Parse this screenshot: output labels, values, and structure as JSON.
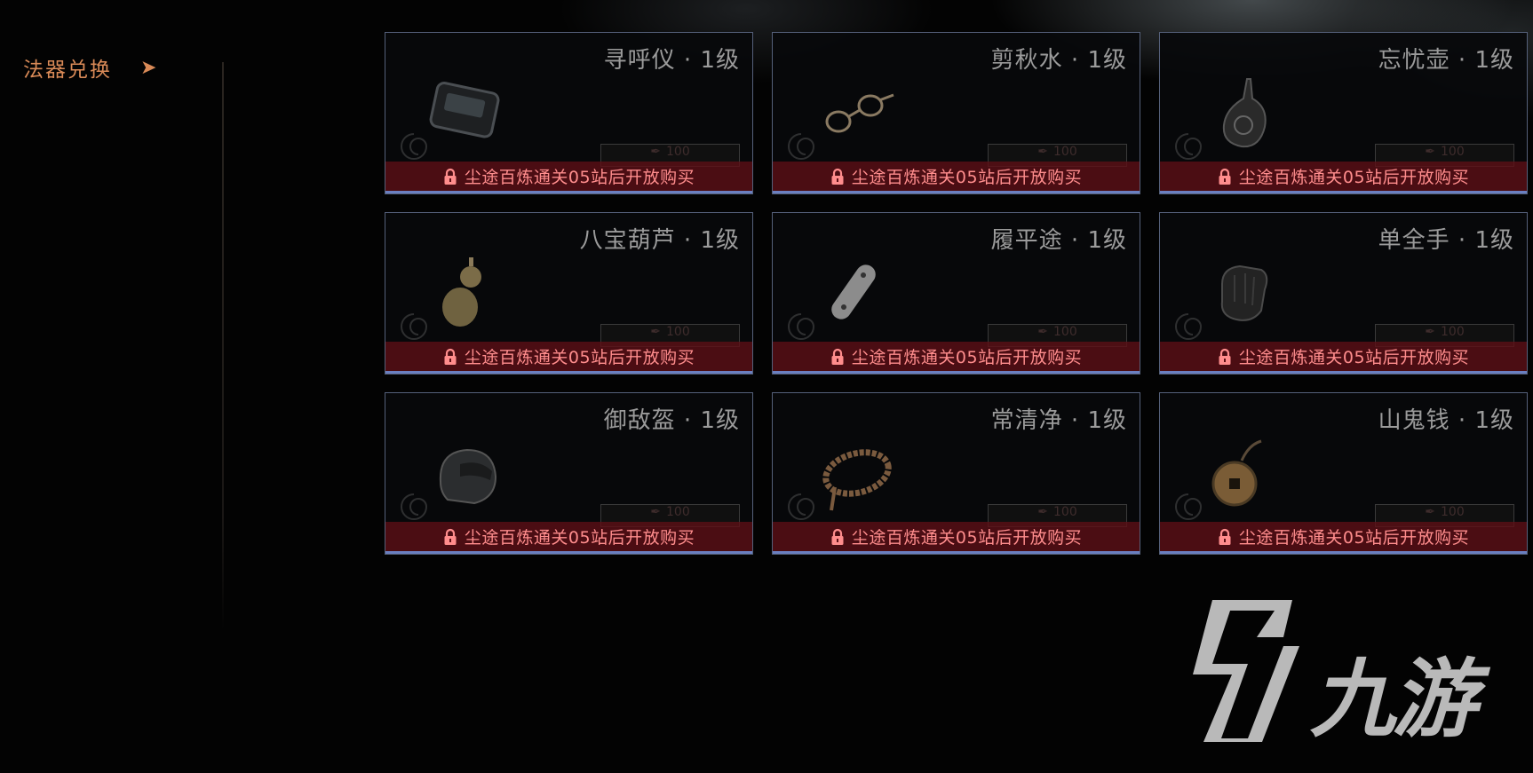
{
  "colors": {
    "accent": "#d98a57",
    "card_border": "#55607a",
    "card_accent_line": "#6a7fc0",
    "lock_bar": "#5f1016",
    "lock_text": "#ff8d8d",
    "title_text": "#9b9b9b"
  },
  "sidebar": {
    "label": "法器兑换",
    "arrow": "➤"
  },
  "lock_icon": "lock-icon",
  "items": [
    {
      "name": "寻呼仪 · 1级",
      "icon": "pager-icon",
      "price": "100",
      "lock_text": "尘途百炼通关05站后开放购买"
    },
    {
      "name": "剪秋水 · 1级",
      "icon": "glasses-icon",
      "price": "100",
      "lock_text": "尘途百炼通关05站后开放购买"
    },
    {
      "name": "忘忧壶 · 1级",
      "icon": "vase-icon",
      "price": "100",
      "lock_text": "尘途百炼通关05站后开放购买"
    },
    {
      "name": "八宝葫芦 · 1级",
      "icon": "gourd-icon",
      "price": "100",
      "lock_text": "尘途百炼通关05站后开放购买"
    },
    {
      "name": "履平途 · 1级",
      "icon": "skateboard-icon",
      "price": "100",
      "lock_text": "尘途百炼通关05站后开放购买"
    },
    {
      "name": "单全手 · 1级",
      "icon": "glove-icon",
      "price": "100",
      "lock_text": "尘途百炼通关05站后开放购买"
    },
    {
      "name": "御敌盔 · 1级",
      "icon": "helmet-icon",
      "price": "100",
      "lock_text": "尘途百炼通关05站后开放购买"
    },
    {
      "name": "常清净 · 1级",
      "icon": "prayer-beads-icon",
      "price": "100",
      "lock_text": "尘途百炼通关05站后开放购买"
    },
    {
      "name": "山鬼钱 · 1级",
      "icon": "coin-icon",
      "price": "100",
      "lock_text": "尘途百炼通关05站后开放购买"
    }
  ],
  "watermark": {
    "logo": "9game-logo",
    "text": "九游"
  }
}
